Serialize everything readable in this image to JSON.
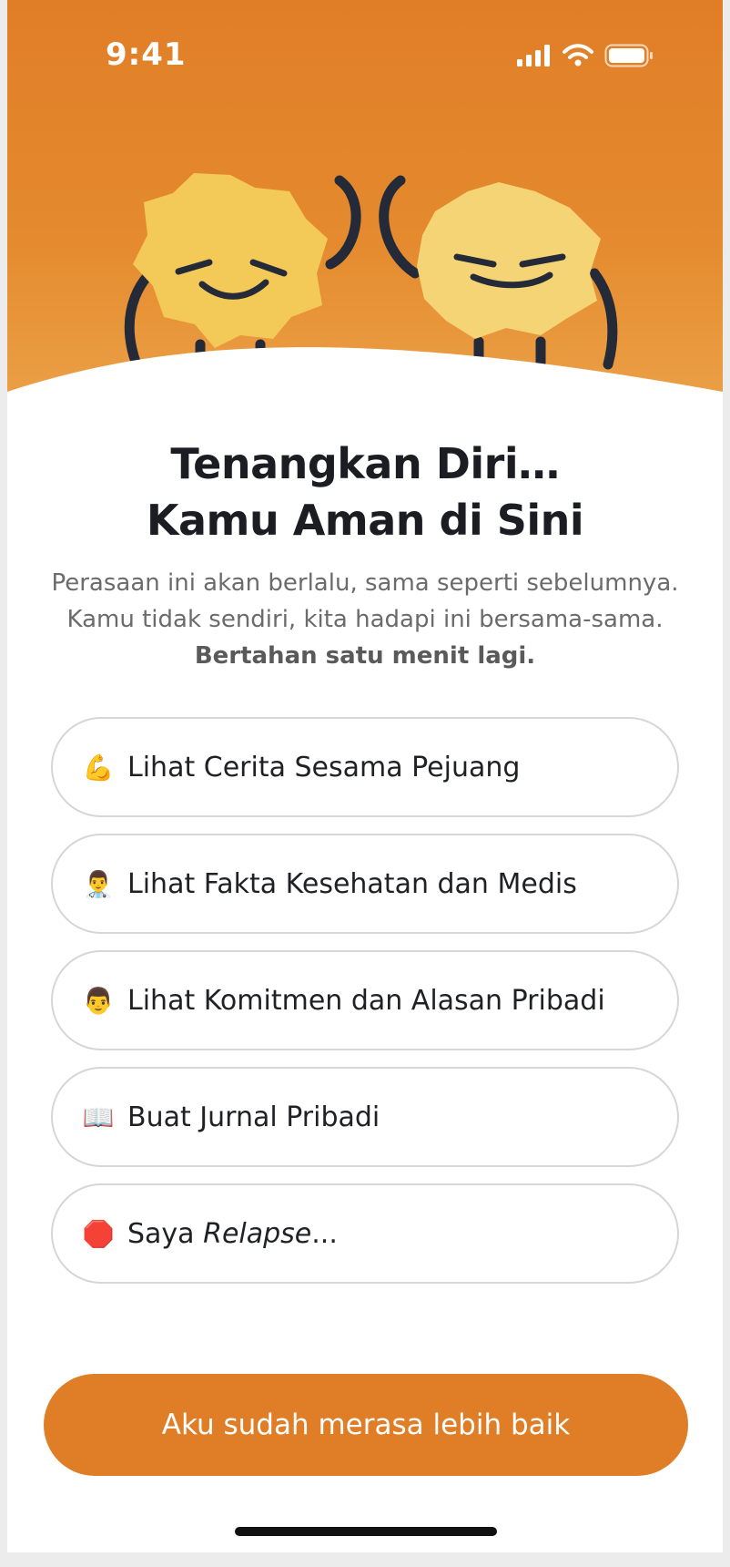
{
  "status_bar": {
    "time": "9:41"
  },
  "icons": {
    "signal": "cellular-signal-icon",
    "wifi": "wifi-icon",
    "battery": "battery-icon"
  },
  "colors": {
    "accent": "#e07e27",
    "mascot_fill": "#f3c957",
    "outline": "#242a38"
  },
  "heading": {
    "line1": "Tenangkan Diri…",
    "line2": "Kamu Aman di Sini"
  },
  "message": {
    "line1": "Perasaan ini akan berlalu, sama seperti sebelumnya.",
    "line2": "Kamu tidak sendiri, kita hadapi ini bersama-sama.",
    "line3": "Bertahan satu menit lagi."
  },
  "options": [
    {
      "emoji": "💪",
      "label": "Lihat Cerita Sesama Pejuang"
    },
    {
      "emoji": "👨‍⚕️",
      "label": "Lihat Fakta Kesehatan dan Medis"
    },
    {
      "emoji": "👨",
      "label": "Lihat Komitmen dan Alasan Pribadi"
    },
    {
      "emoji": "📖",
      "label": "Buat Jurnal Pribadi"
    },
    {
      "emoji": "🛑",
      "label_prefix": "Saya ",
      "label_italic": "Relapse",
      "label_suffix": "..."
    }
  ],
  "cta": {
    "label": "Aku sudah merasa lebih baik"
  }
}
